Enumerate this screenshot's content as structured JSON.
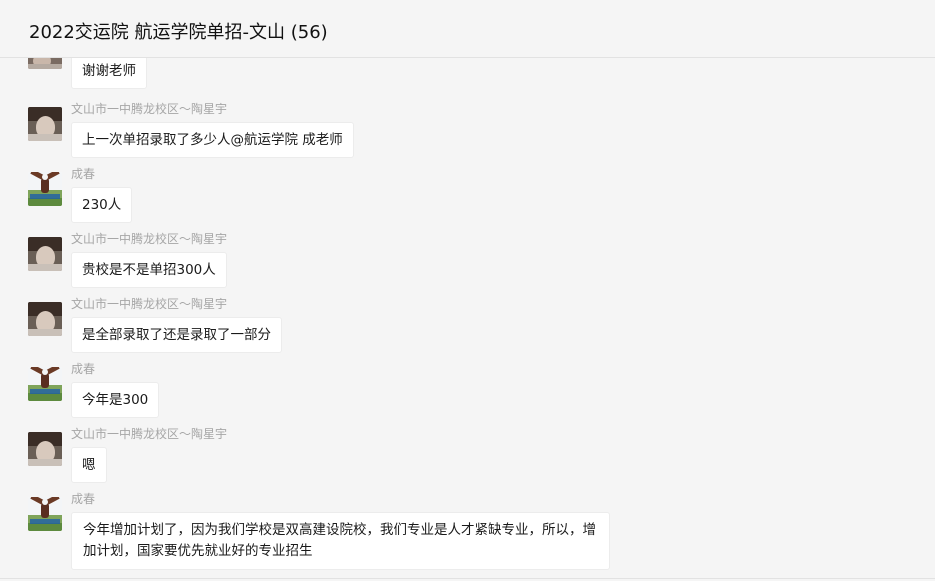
{
  "header": {
    "title": "2022交运院 航运学院单招-文山 (56)"
  },
  "messages": [
    {
      "sender": "",
      "avatar": "person-avatar",
      "text": "谢谢老师"
    },
    {
      "sender": "文山市一中腾龙校区～陶星宇",
      "avatar": "person-avatar",
      "text": "上一次单招录取了多少人@航运学院 成老师"
    },
    {
      "sender": "成春",
      "avatar": "eagle-avatar",
      "text": "230人"
    },
    {
      "sender": "文山市一中腾龙校区～陶星宇",
      "avatar": "person-avatar",
      "text": "贵校是不是单招300人"
    },
    {
      "sender": "文山市一中腾龙校区～陶星宇",
      "avatar": "person-avatar",
      "text": "是全部录取了还是录取了一部分"
    },
    {
      "sender": "成春",
      "avatar": "eagle-avatar",
      "text": "今年是300"
    },
    {
      "sender": "文山市一中腾龙校区～陶星宇",
      "avatar": "person-avatar",
      "text": "嗯"
    },
    {
      "sender": "成春",
      "avatar": "eagle-avatar",
      "text": "今年增加计划了，因为我们学校是双高建设院校，我们专业是人才紧缺专业，所以，增加计划，国家要优先就业好的专业招生"
    }
  ]
}
